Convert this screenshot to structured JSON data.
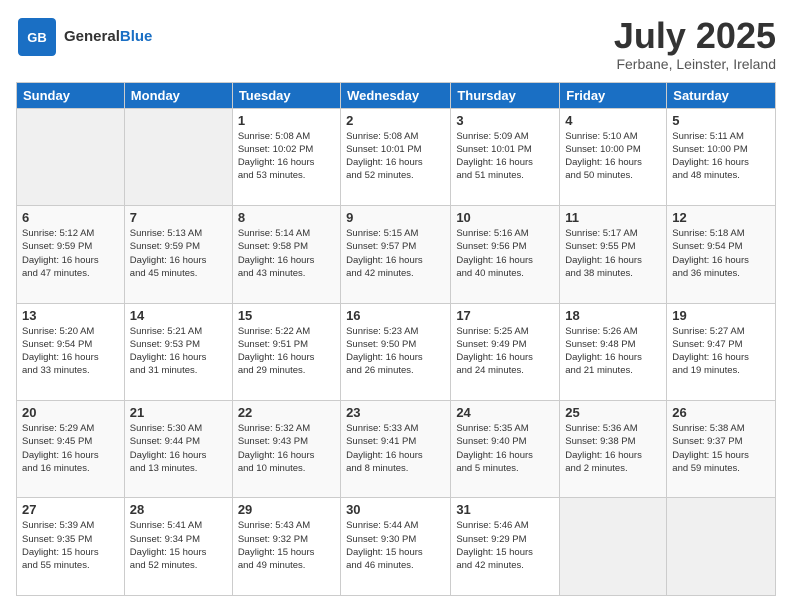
{
  "logo": {
    "general": "General",
    "blue": "Blue"
  },
  "header": {
    "month": "July 2025",
    "location": "Ferbane, Leinster, Ireland"
  },
  "weekdays": [
    "Sunday",
    "Monday",
    "Tuesday",
    "Wednesday",
    "Thursday",
    "Friday",
    "Saturday"
  ],
  "weeks": [
    [
      {
        "day": "",
        "info": ""
      },
      {
        "day": "",
        "info": ""
      },
      {
        "day": "1",
        "info": "Sunrise: 5:08 AM\nSunset: 10:02 PM\nDaylight: 16 hours\nand 53 minutes."
      },
      {
        "day": "2",
        "info": "Sunrise: 5:08 AM\nSunset: 10:01 PM\nDaylight: 16 hours\nand 52 minutes."
      },
      {
        "day": "3",
        "info": "Sunrise: 5:09 AM\nSunset: 10:01 PM\nDaylight: 16 hours\nand 51 minutes."
      },
      {
        "day": "4",
        "info": "Sunrise: 5:10 AM\nSunset: 10:00 PM\nDaylight: 16 hours\nand 50 minutes."
      },
      {
        "day": "5",
        "info": "Sunrise: 5:11 AM\nSunset: 10:00 PM\nDaylight: 16 hours\nand 48 minutes."
      }
    ],
    [
      {
        "day": "6",
        "info": "Sunrise: 5:12 AM\nSunset: 9:59 PM\nDaylight: 16 hours\nand 47 minutes."
      },
      {
        "day": "7",
        "info": "Sunrise: 5:13 AM\nSunset: 9:59 PM\nDaylight: 16 hours\nand 45 minutes."
      },
      {
        "day": "8",
        "info": "Sunrise: 5:14 AM\nSunset: 9:58 PM\nDaylight: 16 hours\nand 43 minutes."
      },
      {
        "day": "9",
        "info": "Sunrise: 5:15 AM\nSunset: 9:57 PM\nDaylight: 16 hours\nand 42 minutes."
      },
      {
        "day": "10",
        "info": "Sunrise: 5:16 AM\nSunset: 9:56 PM\nDaylight: 16 hours\nand 40 minutes."
      },
      {
        "day": "11",
        "info": "Sunrise: 5:17 AM\nSunset: 9:55 PM\nDaylight: 16 hours\nand 38 minutes."
      },
      {
        "day": "12",
        "info": "Sunrise: 5:18 AM\nSunset: 9:54 PM\nDaylight: 16 hours\nand 36 minutes."
      }
    ],
    [
      {
        "day": "13",
        "info": "Sunrise: 5:20 AM\nSunset: 9:54 PM\nDaylight: 16 hours\nand 33 minutes."
      },
      {
        "day": "14",
        "info": "Sunrise: 5:21 AM\nSunset: 9:53 PM\nDaylight: 16 hours\nand 31 minutes."
      },
      {
        "day": "15",
        "info": "Sunrise: 5:22 AM\nSunset: 9:51 PM\nDaylight: 16 hours\nand 29 minutes."
      },
      {
        "day": "16",
        "info": "Sunrise: 5:23 AM\nSunset: 9:50 PM\nDaylight: 16 hours\nand 26 minutes."
      },
      {
        "day": "17",
        "info": "Sunrise: 5:25 AM\nSunset: 9:49 PM\nDaylight: 16 hours\nand 24 minutes."
      },
      {
        "day": "18",
        "info": "Sunrise: 5:26 AM\nSunset: 9:48 PM\nDaylight: 16 hours\nand 21 minutes."
      },
      {
        "day": "19",
        "info": "Sunrise: 5:27 AM\nSunset: 9:47 PM\nDaylight: 16 hours\nand 19 minutes."
      }
    ],
    [
      {
        "day": "20",
        "info": "Sunrise: 5:29 AM\nSunset: 9:45 PM\nDaylight: 16 hours\nand 16 minutes."
      },
      {
        "day": "21",
        "info": "Sunrise: 5:30 AM\nSunset: 9:44 PM\nDaylight: 16 hours\nand 13 minutes."
      },
      {
        "day": "22",
        "info": "Sunrise: 5:32 AM\nSunset: 9:43 PM\nDaylight: 16 hours\nand 10 minutes."
      },
      {
        "day": "23",
        "info": "Sunrise: 5:33 AM\nSunset: 9:41 PM\nDaylight: 16 hours\nand 8 minutes."
      },
      {
        "day": "24",
        "info": "Sunrise: 5:35 AM\nSunset: 9:40 PM\nDaylight: 16 hours\nand 5 minutes."
      },
      {
        "day": "25",
        "info": "Sunrise: 5:36 AM\nSunset: 9:38 PM\nDaylight: 16 hours\nand 2 minutes."
      },
      {
        "day": "26",
        "info": "Sunrise: 5:38 AM\nSunset: 9:37 PM\nDaylight: 15 hours\nand 59 minutes."
      }
    ],
    [
      {
        "day": "27",
        "info": "Sunrise: 5:39 AM\nSunset: 9:35 PM\nDaylight: 15 hours\nand 55 minutes."
      },
      {
        "day": "28",
        "info": "Sunrise: 5:41 AM\nSunset: 9:34 PM\nDaylight: 15 hours\nand 52 minutes."
      },
      {
        "day": "29",
        "info": "Sunrise: 5:43 AM\nSunset: 9:32 PM\nDaylight: 15 hours\nand 49 minutes."
      },
      {
        "day": "30",
        "info": "Sunrise: 5:44 AM\nSunset: 9:30 PM\nDaylight: 15 hours\nand 46 minutes."
      },
      {
        "day": "31",
        "info": "Sunrise: 5:46 AM\nSunset: 9:29 PM\nDaylight: 15 hours\nand 42 minutes."
      },
      {
        "day": "",
        "info": ""
      },
      {
        "day": "",
        "info": ""
      }
    ]
  ]
}
